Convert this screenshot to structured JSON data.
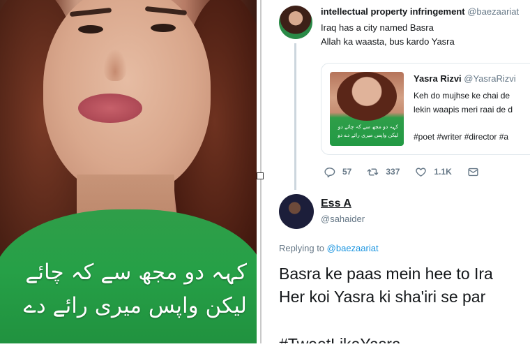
{
  "photo": {
    "urdu_line_1": "کہہ دو مجھ سے کہ چائے",
    "urdu_line_2": "لیکن واپس میری رائے دے"
  },
  "tweet1": {
    "display_name": "intellectual property infringement",
    "handle": "@baezaariat",
    "line1": "Iraq has a city named Basra",
    "line2": "Allah ka waasta, bus kardo Yasra"
  },
  "quoted": {
    "display_name": "Yasra Rizvi",
    "handle": "@YasraRizvi",
    "line1": "Keh do mujhse ke chai de",
    "line2": "lekin waapis meri raai de d",
    "hashtags": "#poet #writer #director #a",
    "image_text_1": "کہہ دو مجھ سے کہ چائے دو",
    "image_text_2": "لیکن واپس میری رائے دے دو"
  },
  "actions": {
    "replies": "57",
    "retweets": "337",
    "likes": "1.1K"
  },
  "tweet2": {
    "display_name": "Ess A",
    "handle": "@sahaider",
    "replying_prefix": "Replying to",
    "replying_handle": "@baezaariat",
    "body_line1": "Basra ke paas mein hee to Ira",
    "body_line2": "Her koi Yasra ki sha'iri se par",
    "hashtag": "#TweetLikeYasra"
  },
  "colors": {
    "handle_gray": "#657786",
    "link_blue": "#1b95e0",
    "shirt_green": "#26a047"
  }
}
